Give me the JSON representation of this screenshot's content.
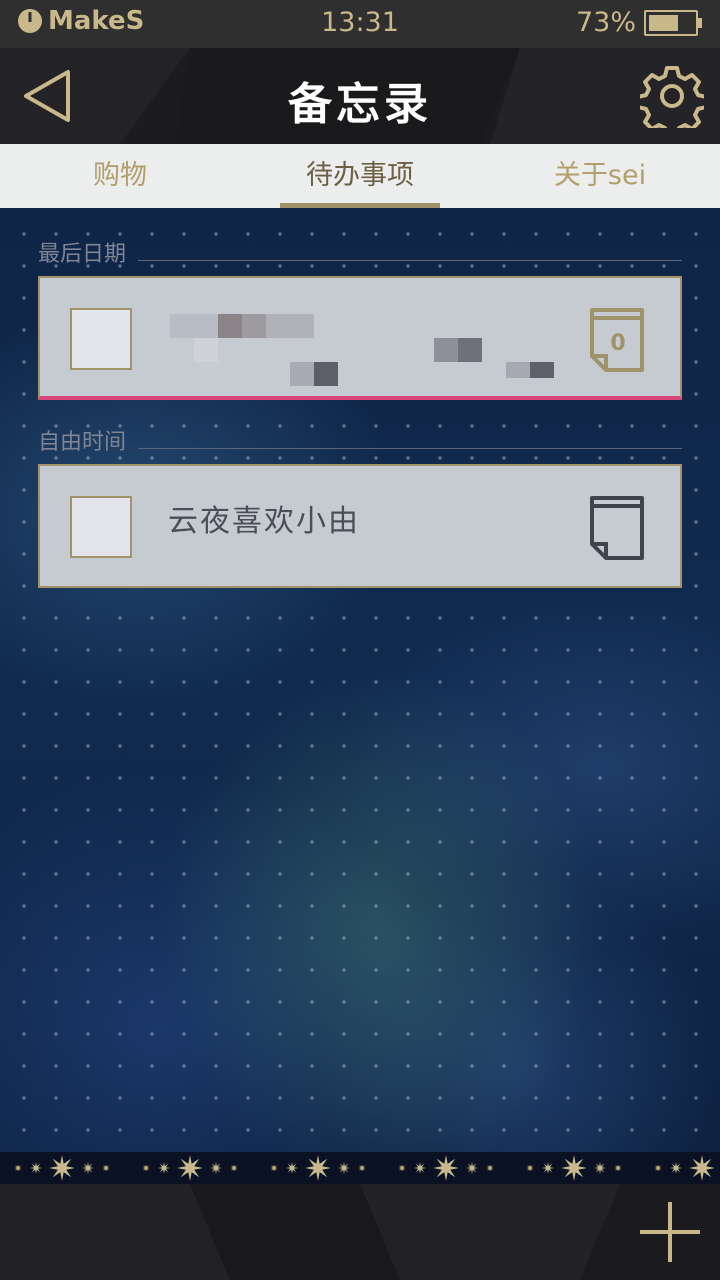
{
  "status_bar": {
    "carrier": "MakeS",
    "time": "13:31",
    "battery_percent": "73%",
    "battery_level": 0.73
  },
  "header": {
    "title": "备忘录",
    "back_icon": "back-triangle-icon",
    "settings_icon": "gear-icon"
  },
  "tabs": [
    {
      "label": "购物",
      "active": false
    },
    {
      "label": "待办事项",
      "active": true
    },
    {
      "label": "关于sei",
      "active": false
    }
  ],
  "sections": [
    {
      "label": "最后日期",
      "items": [
        {
          "text": "",
          "checked": false,
          "icon": "calendar-note-icon",
          "icon_badge": "0",
          "redacted": true
        }
      ]
    },
    {
      "label": "自由时间",
      "items": [
        {
          "text": "云夜喜欢小由",
          "checked": false,
          "icon": "note-icon"
        }
      ]
    }
  ],
  "footer": {
    "add_icon": "plus-icon"
  },
  "colors": {
    "accent_gold": "#a0936a",
    "deadline_bar": "#d8457a",
    "header_bg": "#1c1c1f"
  }
}
